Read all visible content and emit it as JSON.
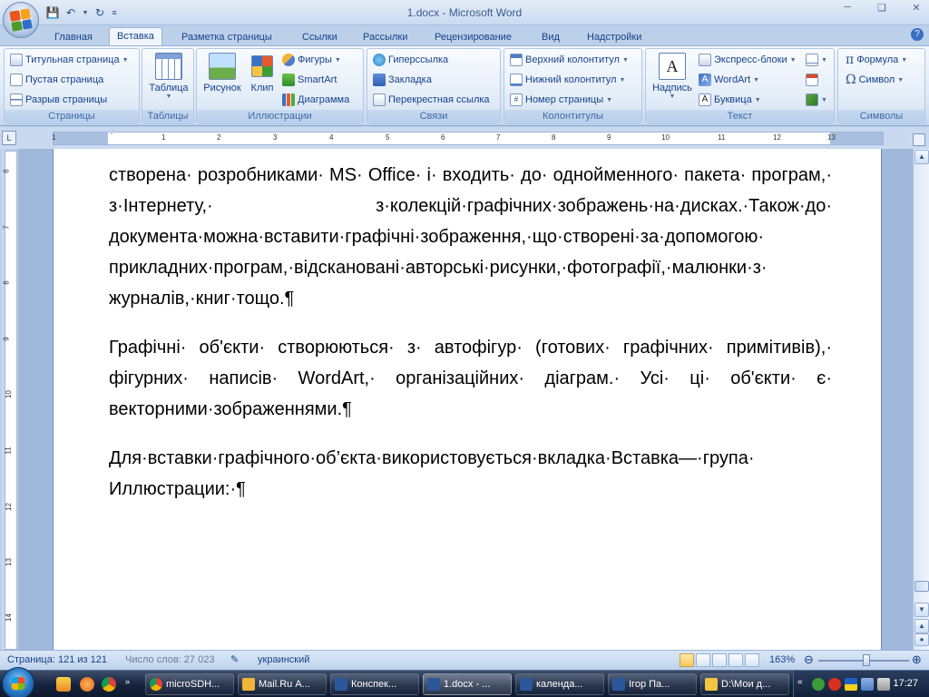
{
  "window": {
    "title": "1.docx - Microsoft Word"
  },
  "tabs": [
    "Главная",
    "Вставка",
    "Разметка страницы",
    "Ссылки",
    "Рассылки",
    "Рецензирование",
    "Вид",
    "Надстройки"
  ],
  "active_tab": "Вставка",
  "ribbon": {
    "pages": {
      "label": "Страницы",
      "cover_page": "Титульная страница",
      "blank_page": "Пустая страница",
      "page_break": "Разрыв страницы"
    },
    "tables": {
      "label": "Таблицы",
      "table": "Таблица"
    },
    "illustrations": {
      "label": "Иллюстрации",
      "picture": "Рисунок",
      "clip": "Клип",
      "shapes": "Фигуры",
      "smartart": "SmartArt",
      "chart": "Диаграмма"
    },
    "links": {
      "label": "Связи",
      "hyperlink": "Гиперссылка",
      "bookmark": "Закладка",
      "cross_reference": "Перекрестная ссылка"
    },
    "header_footer": {
      "label": "Колонтитулы",
      "header": "Верхний колонтитул",
      "footer": "Нижний колонтитул",
      "page_number": "Номер страницы"
    },
    "text": {
      "label": "Текст",
      "text_box": "Надпись",
      "quick_parts": "Экспресс-блоки",
      "wordart": "WordArt",
      "drop_cap": "Буквица"
    },
    "symbols": {
      "label": "Символы",
      "equation": "Формула",
      "symbol": "Символ"
    }
  },
  "ruler": {
    "marks": [
      "1",
      "1",
      "2",
      "3",
      "4",
      "5",
      "6",
      "7",
      "8",
      "9",
      "10",
      "11",
      "12",
      "13"
    ],
    "vmarks": [
      "6",
      "7",
      "8",
      "9",
      "10",
      "11",
      "12",
      "13",
      "14"
    ]
  },
  "document": {
    "paragraphs": [
      "створена· розробниками· MS· Office· і· входить· до· однойменного· пакета· програм,· з·Інтернету,· з·колекцій·графічних·зображень·на·дисках.·Також·до· документа·можна·вставити·графічні·зображення,·що·створені·за·допомогою· прикладних·програм,·відскановані·авторські·рисунки,·фотографії,·малюнки·з· журналів,·книг·тощо.¶",
      "Графічні· об'єкти· створюються· з· автофігур· (готових· графічних· примітивів),· фігурних· написів· WordArt,· організаційних· діаграм.· Усі· ці· об'єкти· є· векторними·зображеннями.¶",
      "Для·вставки·графічного·об’єкта·використовується·вкладка·Вставка—·група· Иллюстрации:·¶"
    ]
  },
  "statusbar": {
    "page": "Страница: 121 из 121",
    "words": "Число слов: 27 023",
    "language": "украинский",
    "zoom": "163%",
    "zoom_level": 0.53
  },
  "taskbar": {
    "tasks": [
      "microSDH...",
      "Mail.Ru А...",
      "Конспек...",
      "1.docx - ...",
      "календа...",
      "Ігор  Па...",
      "D:\\Мои д..."
    ],
    "active_task": "1.docx - ...",
    "clock": "17:27"
  },
  "colors": {
    "accent": "#15428b",
    "ribbon_bg": "#dbe7f5",
    "doc_bg": "#9fb8dc",
    "taskbar": "#15233d"
  }
}
